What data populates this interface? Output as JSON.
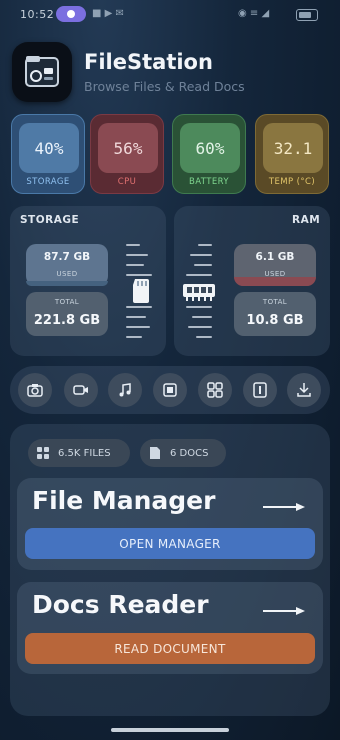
{
  "status_bar": {
    "time": "10:52",
    "mid": "■ ▶ ✉",
    "right": "◉ ≡ ◢"
  },
  "header": {
    "title": "FileStation",
    "subtitle": "Browse Files & Read Docs"
  },
  "stats": [
    {
      "value": "40%",
      "label": "STORAGE",
      "color": "#4f7aa6"
    },
    {
      "value": "56%",
      "label": "CPU",
      "color": "#8a4a52"
    },
    {
      "value": "60%",
      "label": "BATTERY",
      "color": "#4d8a5c"
    },
    {
      "value": "32.1",
      "label": "TEMP (°C)",
      "color": "#8a7640"
    }
  ],
  "storage": {
    "title": "STORAGE",
    "used_value": "87.7 GB",
    "used_label": "USED",
    "total_label": "TOTAL",
    "total_value": "221.8 GB",
    "used_fraction": 0.4
  },
  "ram": {
    "title": "RAM",
    "used_value": "6.1 GB",
    "used_label": "USED",
    "total_label": "TOTAL",
    "total_value": "10.8 GB",
    "used_fraction": 0.56
  },
  "quick_actions": [
    "camera-icon",
    "video-icon",
    "music-icon",
    "image-icon",
    "apps-icon",
    "document-icon",
    "download-icon"
  ],
  "chips": {
    "files": "6.5K FILES",
    "docs": "6 DOCS"
  },
  "file_manager": {
    "title": "File Manager",
    "button": "OPEN MANAGER"
  },
  "docs_reader": {
    "title": "Docs Reader",
    "button": "READ DOCUMENT"
  },
  "colors": {
    "accent_blue": "#4573c0",
    "accent_orange": "#b8663a"
  }
}
